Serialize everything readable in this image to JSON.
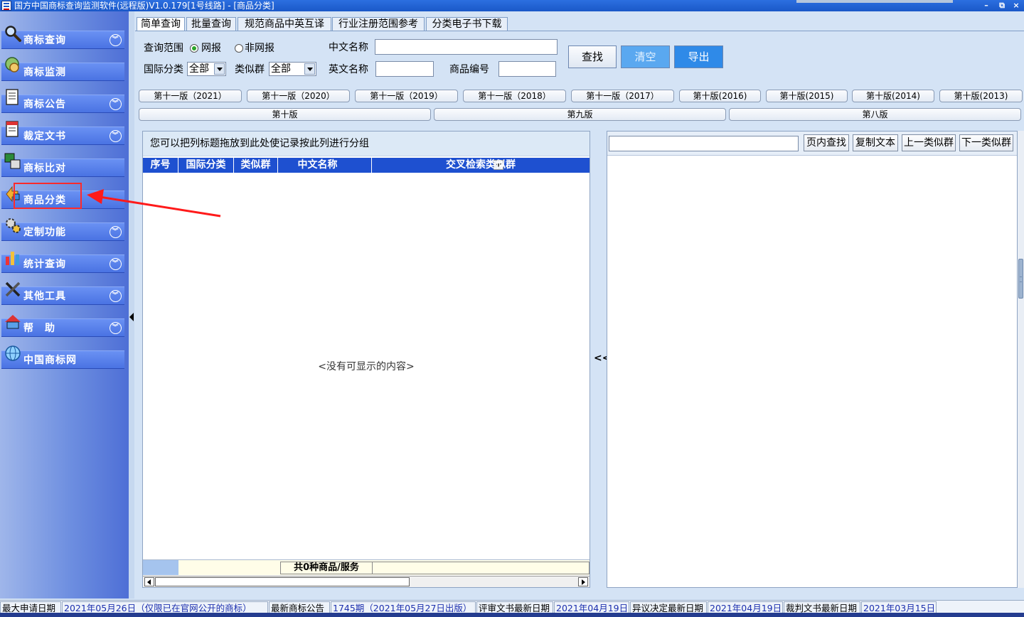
{
  "window": {
    "title": "国方中国商标查询监测软件(远程版)V1.0.179[1号线路] - [商品分类]"
  },
  "sidebar": {
    "items": [
      {
        "label": "商标查询",
        "icon": "magnifier-icon",
        "has_chevron": true
      },
      {
        "label": "商标监测",
        "icon": "monitor-globe-icon",
        "has_chevron": false
      },
      {
        "label": "商标公告",
        "icon": "notice-document-icon",
        "has_chevron": true
      },
      {
        "label": "裁定文书",
        "icon": "document-icon",
        "has_chevron": true
      },
      {
        "label": "商标比对",
        "icon": "compare-windows-icon",
        "has_chevron": false
      },
      {
        "label": "商品分类",
        "icon": "category-arrows-icon",
        "has_chevron": false,
        "highlighted": true
      },
      {
        "label": "定制功能",
        "icon": "gears-icon",
        "has_chevron": true
      },
      {
        "label": "统计查询",
        "icon": "bar-chart-icon",
        "has_chevron": true
      },
      {
        "label": "其他工具",
        "icon": "tools-icon",
        "has_chevron": true
      },
      {
        "label": "帮　助",
        "icon": "help-house-icon",
        "has_chevron": true
      },
      {
        "label": "中国商标网",
        "icon": "globe-icon",
        "has_chevron": false
      }
    ]
  },
  "tabs": [
    {
      "label": "简单查询",
      "active": true
    },
    {
      "label": "批量查询",
      "active": false
    },
    {
      "label": "规范商品中英互译",
      "active": false
    },
    {
      "label": "行业注册范围参考",
      "active": false
    },
    {
      "label": "分类电子书下载",
      "active": false
    }
  ],
  "query": {
    "scope_label": "查询范围",
    "scope_option_1": "网报",
    "scope_option_2": "非网报",
    "scope_selected": "网报",
    "intl_class_label": "国际分类",
    "intl_class_value": "全部",
    "similar_group_label": "类似群",
    "similar_group_value": "全部",
    "cn_name_label": "中文名称",
    "cn_name_value": "",
    "en_name_label": "英文名称",
    "en_name_value": "",
    "product_code_label": "商品编号",
    "product_code_value": "",
    "search_button": "查找",
    "clear_button": "清空",
    "export_button": "导出"
  },
  "versions_row1": [
    "第十一版（2021）",
    "第十一版（2020）",
    "第十一版（2019）",
    "第十一版（2018）",
    "第十一版（2017）",
    "第十版(2016)",
    "第十版(2015)",
    "第十版(2014)",
    "第十版(2013)"
  ],
  "versions_row2": [
    "第十版",
    "第九版",
    "第八版"
  ],
  "grid": {
    "group_hint": "您可以把列标题拖放到此处使记录按此列进行分组",
    "columns": [
      "序号",
      "国际分类",
      "类似群",
      "中文名称",
      "交叉检索类似群"
    ],
    "empty_text": "<没有可显示的内容>",
    "footer_count": "共0种商品/服务"
  },
  "splitter_label": "<<",
  "right_pane": {
    "search_value": "",
    "find_button": "页内查找",
    "copy_button": "复制文本",
    "prev_button": "上一类似群",
    "next_button": "下一类似群"
  },
  "status": [
    {
      "label": "最大申请日期",
      "value": "2021年05月26日（仅限已在官网公开的商标）"
    },
    {
      "label": "最新商标公告",
      "value": "1745期（2021年05月27日出版）"
    },
    {
      "label": "评审文书最新日期",
      "value": "2021年04月19日"
    },
    {
      "label": "异议决定最新日期",
      "value": "2021年04月19日"
    },
    {
      "label": "裁判文书最新日期",
      "value": "2021年03月15日"
    }
  ],
  "colors": {
    "nav": "#4a73e3",
    "grid_header": "#1e50d0",
    "highlight": "#ff2a2a",
    "clear_button": "#5aa8f0",
    "export_button": "#2f8ae8"
  }
}
